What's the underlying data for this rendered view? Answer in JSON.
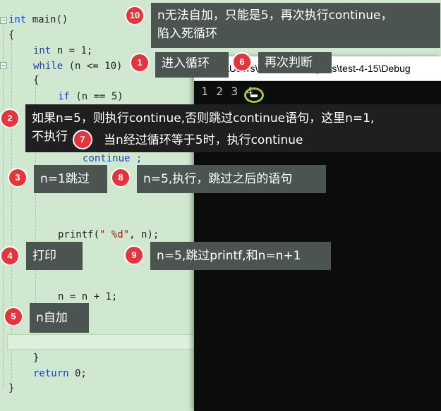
{
  "editor": {
    "lines": {
      "l1_kw": "int",
      "l1_rest": " main()",
      "l2": "{",
      "l3_kw": "int",
      "l3_rest": " n = 1;",
      "l4_kw": "while",
      "l4_rest": " (n <= 10)",
      "l5": "{",
      "l6_kw": "if",
      "l6_rest": " (n == 5)",
      "l7": "continue ;",
      "l8_fn": "printf(",
      "l8_str": "\" %d\"",
      "l8_rest": ", n);",
      "l9": "n = n + 1;",
      "l10": "}",
      "l11_kw": "return",
      "l11_rest": " 0;",
      "l12": "}"
    }
  },
  "console": {
    "title": "C:\\Users\\DELL\\Desktop\\.vs\\test-4-15\\Debug",
    "output": "1 2 3 4"
  },
  "annotations": [
    {
      "num": "1",
      "text": "进入循环"
    },
    {
      "num": "2",
      "text_line1": "如果n=5，则执行continue,否则跳过continue语句，这里n=1,",
      "text_line2": "不执行"
    },
    {
      "num": "3",
      "text": "n=1跳过"
    },
    {
      "num": "4",
      "text": "打印"
    },
    {
      "num": "5",
      "text": "n自加"
    },
    {
      "num": "6",
      "text": "再次判断"
    },
    {
      "num": "7",
      "text": "当n经过循环等于5时，执行continue"
    },
    {
      "num": "8",
      "text": "n=5,执行，跳过之后的语句"
    },
    {
      "num": "9",
      "text": "n=5,跳过printf,和n=n+1"
    },
    {
      "num": "10",
      "text_line1": "n无法自加，只能是5，再次执行continue，",
      "text_line2": "陷入死循环"
    }
  ]
}
